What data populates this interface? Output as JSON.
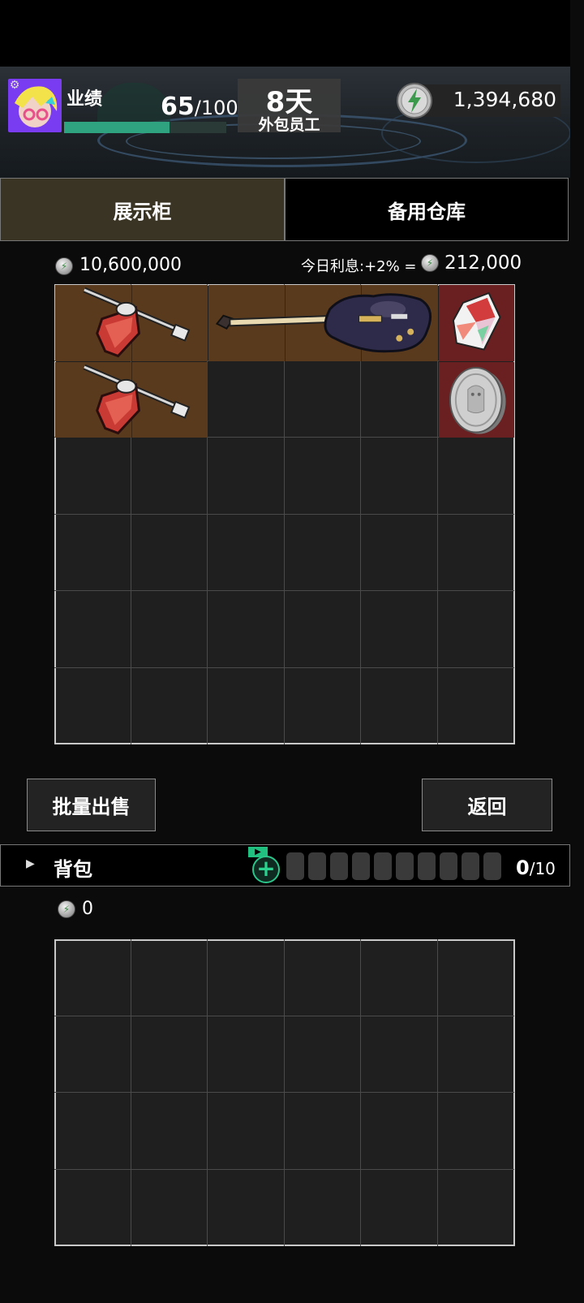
{
  "header": {
    "performance_label": "业绩",
    "performance_value": "65",
    "performance_max": "/100",
    "performance_progress": 0.65,
    "days": "8天",
    "role": "外包员工",
    "money": "1,394,680"
  },
  "tabs": [
    {
      "label": "展示柜",
      "active": true
    },
    {
      "label": "备用仓库",
      "active": false
    }
  ],
  "display_case": {
    "total_value": "10,600,000",
    "interest_label": "今日利息:+2% =",
    "interest_value": "212,000",
    "columns": 6,
    "rows": 6,
    "items": [
      {
        "name": "red-gem-pickaxe",
        "row": 1,
        "col": 1,
        "w": 2,
        "h": 1
      },
      {
        "name": "guitar",
        "row": 1,
        "col": 3,
        "w": 3,
        "h": 1
      },
      {
        "name": "rainbow-crystal",
        "row": 1,
        "col": 6,
        "w": 1,
        "h": 1
      },
      {
        "name": "red-gem-pickaxe",
        "row": 2,
        "col": 1,
        "w": 2,
        "h": 1
      },
      {
        "name": "silver-coin",
        "row": 2,
        "col": 6,
        "w": 1,
        "h": 1
      }
    ]
  },
  "buttons": {
    "batch_sell": "批量出售",
    "back": "返回"
  },
  "backpack": {
    "label": "背包",
    "count": "0",
    "max": "/10",
    "value": "0",
    "columns": 6,
    "rows": 4
  },
  "colors": {
    "accent_green": "#2fa37f",
    "tab_active": "#3a3424",
    "item_brown": "#5a3a1c",
    "item_red": "#6a1f21"
  }
}
